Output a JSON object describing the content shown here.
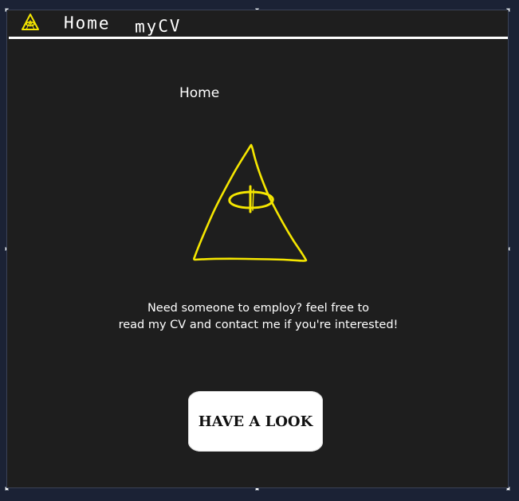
{
  "nav": {
    "logo_icon": "eye-of-providence-icon",
    "home_label": "Home",
    "cv_label": "myCV"
  },
  "page": {
    "title": "Home",
    "hero_icon": "eye-of-providence-icon",
    "intro_line1": "Need someone to employ? feel free to",
    "intro_line2": "read my CV and contact me if you're interested!",
    "cta_label": "HAVE A LOOK"
  },
  "colors": {
    "background": "#1e1e1e",
    "outer_background": "#1b2235",
    "accent_yellow": "#f5e600",
    "text": "#ffffff",
    "button_bg": "#ffffff"
  }
}
